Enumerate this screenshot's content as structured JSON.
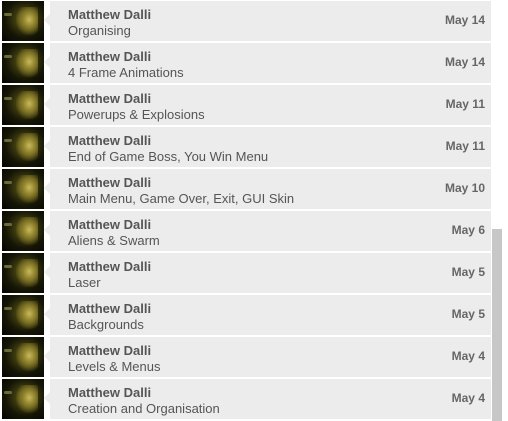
{
  "commits": [
    {
      "author": "Matthew Dalli",
      "message": "Organising",
      "date": "May 14"
    },
    {
      "author": "Matthew Dalli",
      "message": "4 Frame Animations",
      "date": "May 14"
    },
    {
      "author": "Matthew Dalli",
      "message": "Powerups & Explosions",
      "date": "May 11"
    },
    {
      "author": "Matthew Dalli",
      "message": "End of Game Boss, You Win Menu",
      "date": "May 11"
    },
    {
      "author": "Matthew Dalli",
      "message": "Main Menu, Game Over, Exit, GUI Skin",
      "date": "May 10"
    },
    {
      "author": "Matthew Dalli",
      "message": "Aliens & Swarm",
      "date": "May 6"
    },
    {
      "author": "Matthew Dalli",
      "message": "Laser",
      "date": "May 5"
    },
    {
      "author": "Matthew Dalli",
      "message": "Backgrounds",
      "date": "May 5"
    },
    {
      "author": "Matthew Dalli",
      "message": "Levels & Menus",
      "date": "May 4"
    },
    {
      "author": "Matthew Dalli",
      "message": "Creation and Organisation",
      "date": "May 4"
    }
  ],
  "colors": {
    "bubble": "#ececec",
    "text": "#555555",
    "scrollbar_thumb": "#c7c7c7"
  }
}
